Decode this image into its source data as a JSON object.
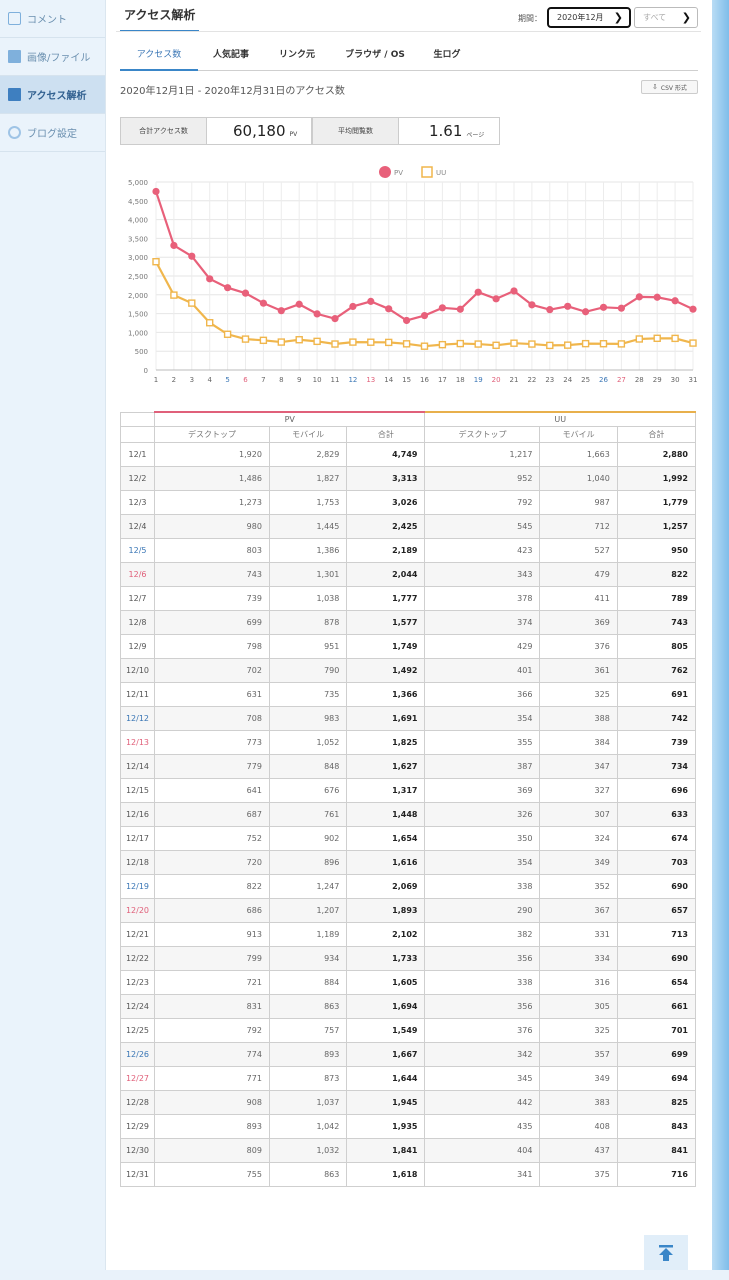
{
  "sidebar": {
    "items": [
      {
        "label": "コメント",
        "icon": "comment-icon"
      },
      {
        "label": "画像/ファイル",
        "icon": "image-icon"
      },
      {
        "label": "アクセス解析",
        "icon": "stats-icon"
      },
      {
        "label": "ブログ設定",
        "icon": "settings-icon"
      }
    ]
  },
  "header": {
    "title": "アクセス解析",
    "period_label": "期間：",
    "period_value": "2020年12月",
    "filter_value": "すべて"
  },
  "tabs": [
    "アクセス数",
    "人気記事",
    "リンク元",
    "ブラウザ / OS",
    "生ログ"
  ],
  "range_text": "2020年12月1日 - 2020年12月31日のアクセス数",
  "csv_label": "CSV 形式",
  "summary": {
    "total_label": "合計アクセス数",
    "total_value": "60,180",
    "total_unit": "PV",
    "avg_label": "平均閲覧数",
    "avg_value": "1.61",
    "avg_unit": "ページ"
  },
  "colors": {
    "pv": "#e8607a",
    "uu": "#f0b64c",
    "accent": "#3a86c8"
  },
  "chart_data": {
    "type": "line",
    "x": [
      1,
      2,
      3,
      4,
      5,
      6,
      7,
      8,
      9,
      10,
      11,
      12,
      13,
      14,
      15,
      16,
      17,
      18,
      19,
      20,
      21,
      22,
      23,
      24,
      25,
      26,
      27,
      28,
      29,
      30,
      31
    ],
    "saturdays": [
      5,
      12,
      19,
      26
    ],
    "sundays": [
      6,
      13,
      20,
      27
    ],
    "ylim": [
      0,
      5000
    ],
    "yticks": [
      "0",
      "500",
      "1,000",
      "1,500",
      "2,000",
      "2,500",
      "3,000",
      "3,500",
      "4,000",
      "4,500",
      "5,000"
    ],
    "ytick_values": [
      0,
      500,
      1000,
      1500,
      2000,
      2500,
      3000,
      3500,
      4000,
      4500,
      5000
    ],
    "grid": true,
    "legend": "top-center",
    "series": [
      {
        "name": "PV",
        "values": [
          4749,
          3313,
          3026,
          2425,
          2189,
          2044,
          1777,
          1577,
          1749,
          1492,
          1366,
          1691,
          1825,
          1627,
          1317,
          1448,
          1654,
          1616,
          2069,
          1893,
          2102,
          1733,
          1605,
          1694,
          1549,
          1667,
          1644,
          1945,
          1935,
          1841,
          1618
        ]
      },
      {
        "name": "UU",
        "values": [
          2880,
          1992,
          1779,
          1257,
          950,
          822,
          789,
          743,
          805,
          762,
          691,
          742,
          739,
          734,
          696,
          633,
          674,
          703,
          690,
          657,
          713,
          690,
          654,
          661,
          701,
          699,
          694,
          825,
          843,
          841,
          716
        ]
      }
    ]
  },
  "table": {
    "group_pv": "PV",
    "group_uu": "UU",
    "sub_headers": [
      "デスクトップ",
      "モバイル",
      "合計",
      "デスクトップ",
      "モバイル",
      "合計"
    ],
    "rows": [
      [
        "12/1",
        "1,920",
        "2,829",
        "4,749",
        "1,217",
        "1,663",
        "2,880"
      ],
      [
        "12/2",
        "1,486",
        "1,827",
        "3,313",
        "952",
        "1,040",
        "1,992"
      ],
      [
        "12/3",
        "1,273",
        "1,753",
        "3,026",
        "792",
        "987",
        "1,779"
      ],
      [
        "12/4",
        "980",
        "1,445",
        "2,425",
        "545",
        "712",
        "1,257"
      ],
      [
        "12/5",
        "803",
        "1,386",
        "2,189",
        "423",
        "527",
        "950"
      ],
      [
        "12/6",
        "743",
        "1,301",
        "2,044",
        "343",
        "479",
        "822"
      ],
      [
        "12/7",
        "739",
        "1,038",
        "1,777",
        "378",
        "411",
        "789"
      ],
      [
        "12/8",
        "699",
        "878",
        "1,577",
        "374",
        "369",
        "743"
      ],
      [
        "12/9",
        "798",
        "951",
        "1,749",
        "429",
        "376",
        "805"
      ],
      [
        "12/10",
        "702",
        "790",
        "1,492",
        "401",
        "361",
        "762"
      ],
      [
        "12/11",
        "631",
        "735",
        "1,366",
        "366",
        "325",
        "691"
      ],
      [
        "12/12",
        "708",
        "983",
        "1,691",
        "354",
        "388",
        "742"
      ],
      [
        "12/13",
        "773",
        "1,052",
        "1,825",
        "355",
        "384",
        "739"
      ],
      [
        "12/14",
        "779",
        "848",
        "1,627",
        "387",
        "347",
        "734"
      ],
      [
        "12/15",
        "641",
        "676",
        "1,317",
        "369",
        "327",
        "696"
      ],
      [
        "12/16",
        "687",
        "761",
        "1,448",
        "326",
        "307",
        "633"
      ],
      [
        "12/17",
        "752",
        "902",
        "1,654",
        "350",
        "324",
        "674"
      ],
      [
        "12/18",
        "720",
        "896",
        "1,616",
        "354",
        "349",
        "703"
      ],
      [
        "12/19",
        "822",
        "1,247",
        "2,069",
        "338",
        "352",
        "690"
      ],
      [
        "12/20",
        "686",
        "1,207",
        "1,893",
        "290",
        "367",
        "657"
      ],
      [
        "12/21",
        "913",
        "1,189",
        "2,102",
        "382",
        "331",
        "713"
      ],
      [
        "12/22",
        "799",
        "934",
        "1,733",
        "356",
        "334",
        "690"
      ],
      [
        "12/23",
        "721",
        "884",
        "1,605",
        "338",
        "316",
        "654"
      ],
      [
        "12/24",
        "831",
        "863",
        "1,694",
        "356",
        "305",
        "661"
      ],
      [
        "12/25",
        "792",
        "757",
        "1,549",
        "376",
        "325",
        "701"
      ],
      [
        "12/26",
        "774",
        "893",
        "1,667",
        "342",
        "357",
        "699"
      ],
      [
        "12/27",
        "771",
        "873",
        "1,644",
        "345",
        "349",
        "694"
      ],
      [
        "12/28",
        "908",
        "1,037",
        "1,945",
        "442",
        "383",
        "825"
      ],
      [
        "12/29",
        "893",
        "1,042",
        "1,935",
        "435",
        "408",
        "843"
      ],
      [
        "12/30",
        "809",
        "1,032",
        "1,841",
        "404",
        "437",
        "841"
      ],
      [
        "12/31",
        "755",
        "863",
        "1,618",
        "341",
        "375",
        "716"
      ]
    ]
  }
}
